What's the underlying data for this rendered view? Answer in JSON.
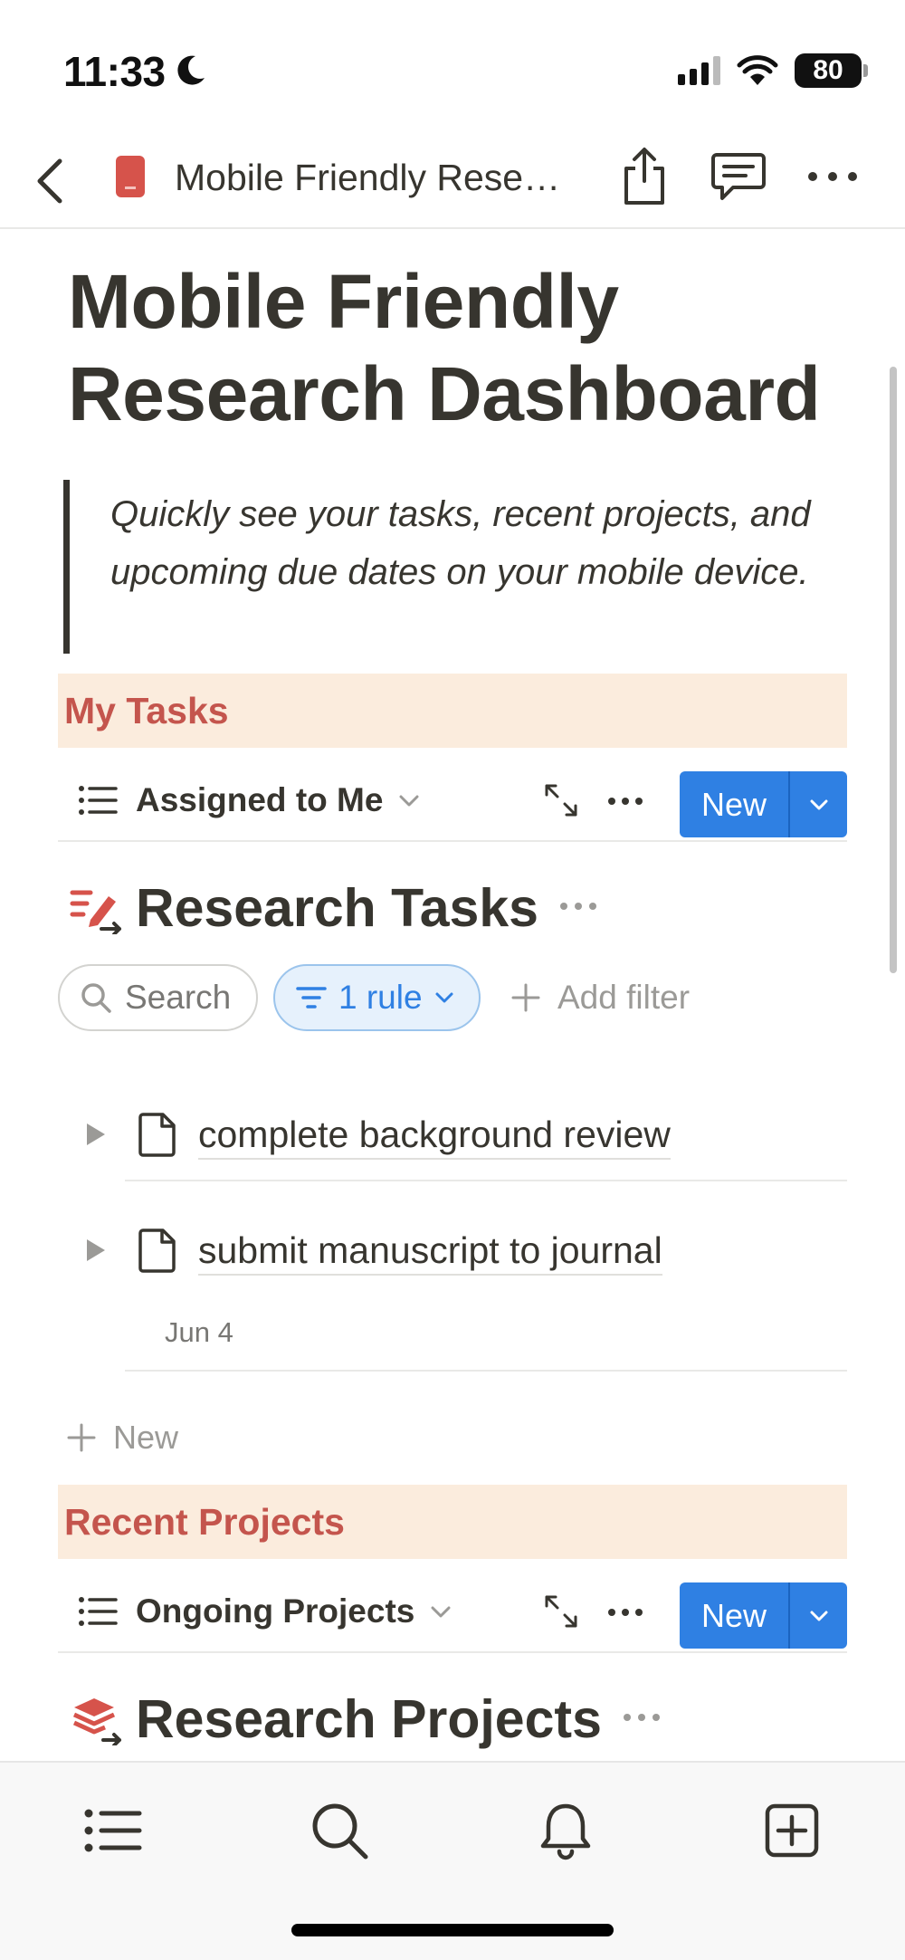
{
  "status_bar": {
    "time": "11:33",
    "battery": "80"
  },
  "nav": {
    "title": "Mobile Friendly Rese…"
  },
  "page": {
    "title": "Mobile Friendly Research Dashboard",
    "quote": "Quickly see your tasks, recent projects, and upcoming due dates on your mobile device."
  },
  "tasks_section": {
    "header": "My Tasks",
    "view_name": "Assigned to Me",
    "new_label": "New",
    "database_title": "Research Tasks",
    "search_label": "Search",
    "rule_label": "1 rule",
    "add_filter_label": "Add filter",
    "items": [
      {
        "title": "complete background review",
        "date": ""
      },
      {
        "title": "submit manuscript to journal",
        "date": "Jun 4"
      }
    ],
    "add_new_label": "New"
  },
  "projects_section": {
    "header": "Recent Projects",
    "view_name": "Ongoing Projects",
    "new_label": "New",
    "database_title": "Research Projects"
  },
  "colors": {
    "accent_blue": "#2f80e3",
    "section_bg": "#fbecdd",
    "section_text": "#c4554d",
    "text": "#37352f"
  },
  "icons": {
    "tabbar": [
      "list-icon",
      "search-icon",
      "bell-icon",
      "plus-square-icon"
    ]
  }
}
